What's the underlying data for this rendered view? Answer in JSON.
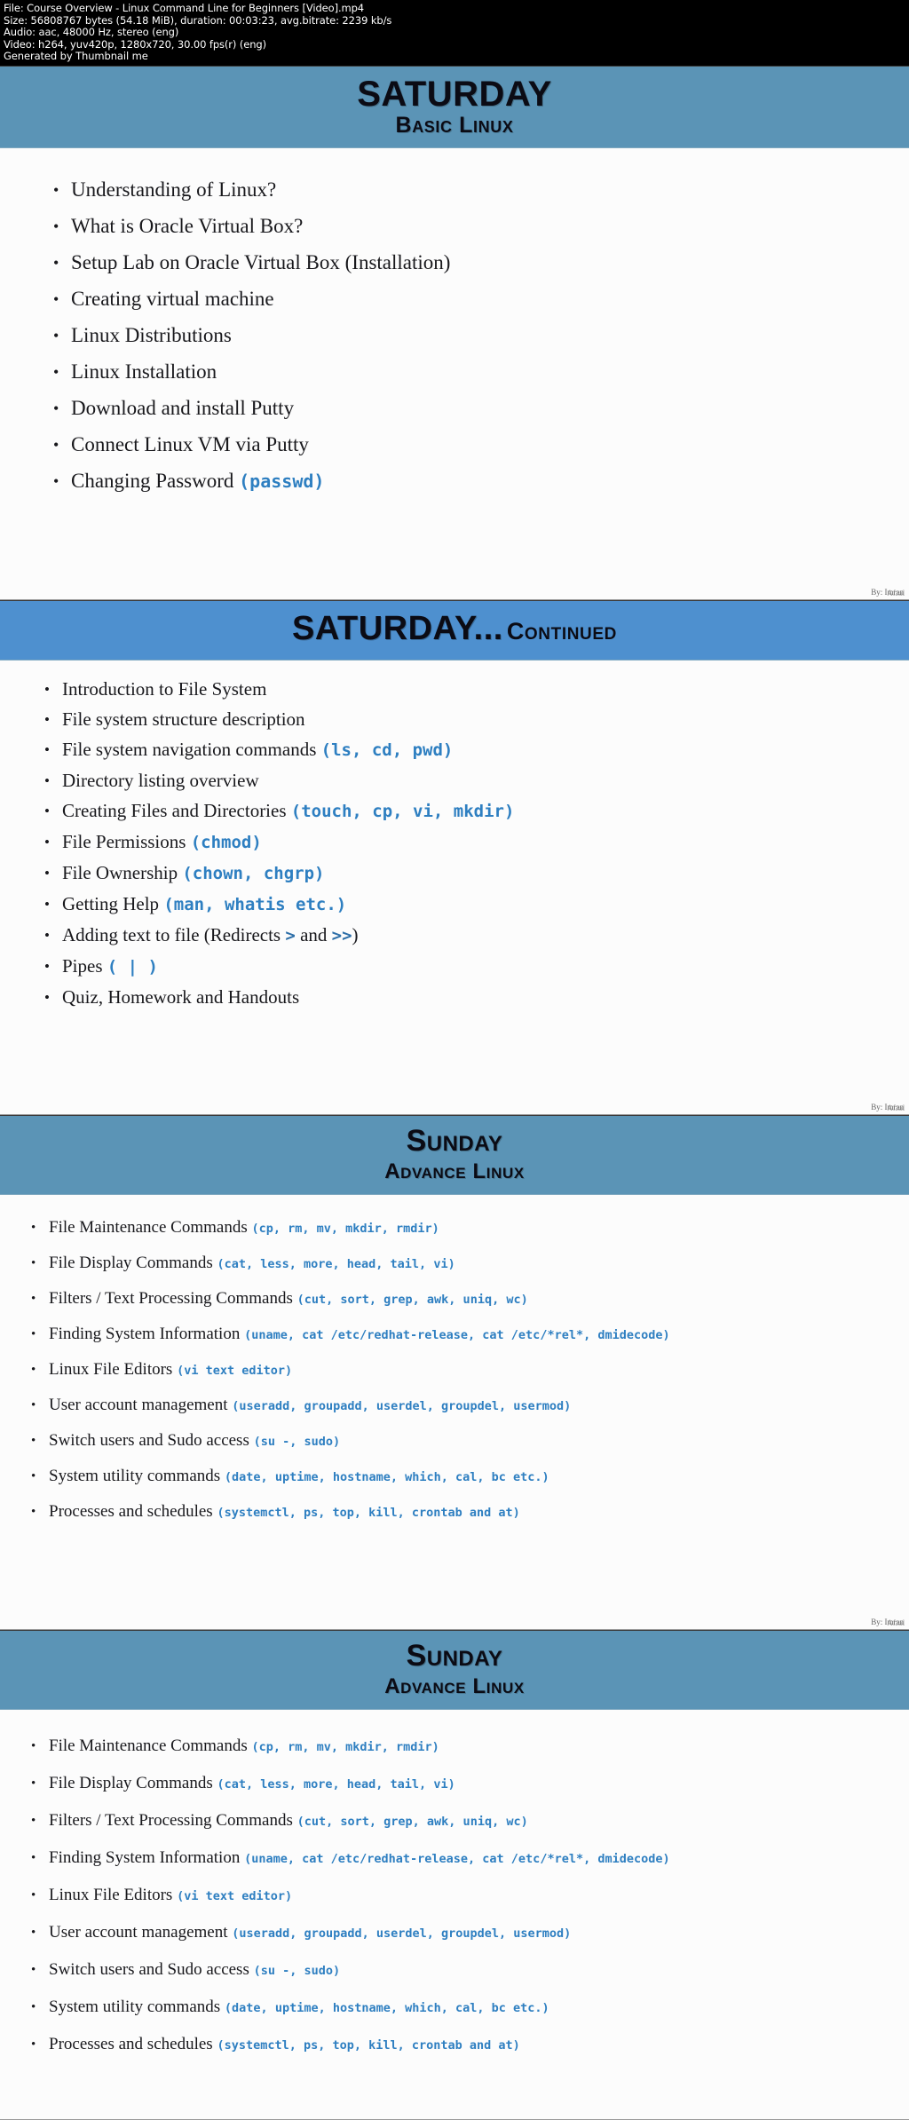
{
  "video_info": {
    "lines": [
      "File: Course Overview - Linux Command Line for Beginners [Video].mp4",
      "Size: 56808767 bytes (54.18 MiB), duration: 00:03:23, avg.bitrate: 2239 kb/s",
      "Audio: aac, 48000 Hz, stereo (eng)",
      "Video: h264, yuv420p, 1280x720, 30.00 fps(r) (eng)",
      "Generated by Thumbnail me"
    ]
  },
  "colors": {
    "band_blue": "#5b94b6",
    "band_blue_bright": "#4e90cf",
    "code_blue": "#2e7fc1",
    "slide_bg": "#fcfcfc",
    "text": "#18181c"
  },
  "watermark": {
    "text": "By: Imran",
    "overlay": "Afzal"
  },
  "slides": [
    {
      "id": "slide-saturday-basic-linux",
      "title": "SATURDAY",
      "subtitle": "Basic Linux",
      "bullets": [
        {
          "text": "Understanding of Linux?",
          "code": ""
        },
        {
          "text": "What is Oracle Virtual Box?",
          "code": ""
        },
        {
          "text": "Setup Lab on Oracle Virtual Box (Installation)",
          "code": ""
        },
        {
          "text": "Creating virtual machine",
          "code": ""
        },
        {
          "text": "Linux Distributions",
          "code": ""
        },
        {
          "text": "Linux Installation",
          "code": ""
        },
        {
          "text": "Download and install Putty",
          "code": ""
        },
        {
          "text": "Connect Linux VM via Putty",
          "code": ""
        },
        {
          "text": "Changing Password",
          "code": "(passwd)"
        }
      ]
    },
    {
      "id": "slide-saturday-continued",
      "title": "SATURDAY...",
      "continued": "Continued",
      "bullets": [
        {
          "text": "Introduction to File System",
          "code": ""
        },
        {
          "text": "File system structure description",
          "code": ""
        },
        {
          "text": "File system navigation commands",
          "code": "(ls, cd, pwd)"
        },
        {
          "text": "Directory listing overview",
          "code": ""
        },
        {
          "text": "Creating Files and Directories",
          "code": "(touch, cp, vi, mkdir)"
        },
        {
          "text": "File Permissions",
          "code": "(chmod)"
        },
        {
          "text": "File Ownership",
          "code": "(chown, chgrp)"
        },
        {
          "text": "Getting Help",
          "code": "(man, whatis etc.)"
        },
        {
          "text": "Adding text to file (Redirects > and >>)",
          "code": "",
          "redirect": true
        },
        {
          "text": "Pipes",
          "code": "( | )"
        },
        {
          "text": "Quiz, Homework and Handouts",
          "code": ""
        }
      ],
      "redirect_line": {
        "pre": "Adding text to file (Redirects ",
        "op1": ">",
        "mid": " and ",
        "op2": ">>",
        "post": ")"
      }
    },
    {
      "id": "slide-sunday-advance-linux-1",
      "title": "Sunday",
      "subtitle": "Advance Linux",
      "bullets": [
        {
          "text": "File Maintenance Commands",
          "code": "(cp, rm, mv, mkdir, rmdir)"
        },
        {
          "text": "File Display Commands",
          "code": "(cat, less, more, head, tail, vi)"
        },
        {
          "text": "Filters / Text Processing Commands",
          "code": "(cut, sort, grep, awk, uniq, wc)"
        },
        {
          "text": "Finding System Information",
          "code": "(uname, cat /etc/redhat-release, cat /etc/*rel*, dmidecode)"
        },
        {
          "text": "Linux File Editors",
          "code": "(vi text editor)"
        },
        {
          "text": "User account management",
          "code": "(useradd, groupadd, userdel, groupdel, usermod)"
        },
        {
          "text": "Switch users and Sudo access",
          "code": "(su -, sudo)"
        },
        {
          "text": "System utility commands",
          "code": "(date, uptime, hostname, which, cal, bc etc.)"
        },
        {
          "text": "Processes and schedules",
          "code": "(systemctl, ps, top, kill, crontab and at)"
        }
      ]
    },
    {
      "id": "slide-sunday-advance-linux-2",
      "title": "Sunday",
      "subtitle": "Advance Linux",
      "bullets": [
        {
          "text": "File Maintenance Commands",
          "code": "(cp, rm, mv, mkdir, rmdir)"
        },
        {
          "text": "File Display Commands",
          "code": "(cat, less, more, head, tail, vi)"
        },
        {
          "text": "Filters / Text Processing Commands",
          "code": "(cut, sort, grep, awk, uniq, wc)"
        },
        {
          "text": "Finding System Information",
          "code": "(uname, cat /etc/redhat-release, cat /etc/*rel*, dmidecode)"
        },
        {
          "text": "Linux File Editors",
          "code": "(vi text editor)"
        },
        {
          "text": "User account management",
          "code": "(useradd, groupadd, userdel, groupdel, usermod)"
        },
        {
          "text": "Switch users and Sudo access",
          "code": "(su -, sudo)"
        },
        {
          "text": "System utility commands",
          "code": "(date, uptime, hostname, which, cal, bc etc.)"
        },
        {
          "text": "Processes and schedules",
          "code": "(systemctl, ps, top, kill, crontab and at)"
        }
      ]
    }
  ]
}
